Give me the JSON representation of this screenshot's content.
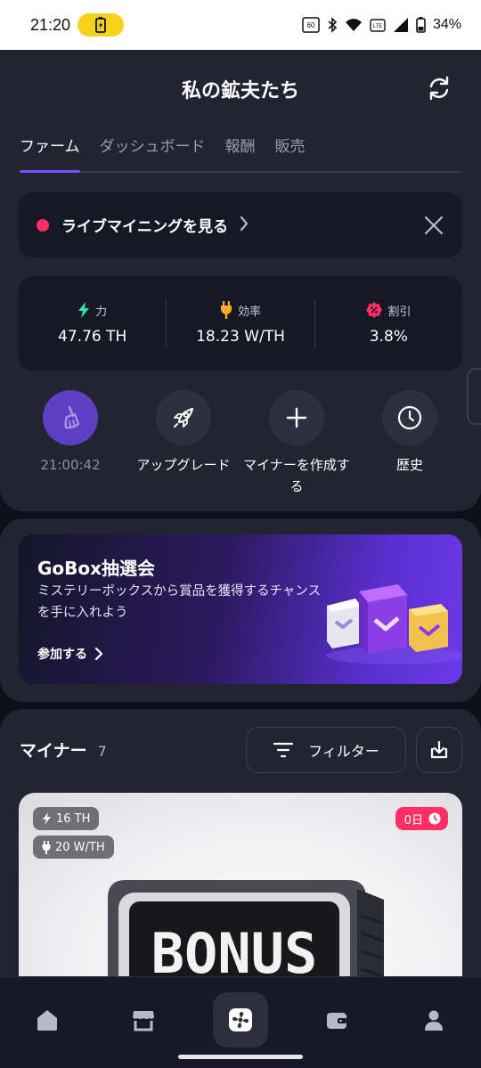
{
  "status_bar": {
    "time": "21:20",
    "battery_percent": "34%",
    "icons": [
      "battery-saver-icon",
      "data-speed-icon",
      "bluetooth-icon",
      "wifi-icon",
      "volte-icon",
      "signal-icon",
      "battery-icon"
    ]
  },
  "header": {
    "title": "私の鉱夫たち"
  },
  "tabs": [
    {
      "label": "ファーム",
      "active": true
    },
    {
      "label": "ダッシュボード",
      "active": false
    },
    {
      "label": "報酬",
      "active": false
    },
    {
      "label": "販売",
      "active": false
    }
  ],
  "live_banner": {
    "label": "ライブマイニングを見る"
  },
  "stats": {
    "power": {
      "label": "力",
      "value": "47.76 TH"
    },
    "efficiency": {
      "label": "効率",
      "value": "18.23 W/TH"
    },
    "discount": {
      "label": "割引",
      "value": "3.8%"
    }
  },
  "actions": {
    "timer": "21:00:42",
    "upgrade": "アップグレード",
    "create_miner": "マイナーを作成する",
    "history": "歴史"
  },
  "promo": {
    "title": "GoBox抽選会",
    "description": "ミステリーボックスから賞品を獲得するチャンスを手に入れよう",
    "join_label": "参加する"
  },
  "miners": {
    "title": "マイナー",
    "count": "7",
    "filter_label": "フィルター",
    "card": {
      "power": "16 TH",
      "efficiency": "20 W/TH",
      "days": "0日",
      "image_text": "BONUS"
    }
  },
  "colors": {
    "accent": "#7c4dff",
    "live_dot": "#ff2e63",
    "power_icon": "#2ee6a8",
    "efficiency_icon": "#ffa928",
    "discount_icon": "#ff2e63"
  }
}
